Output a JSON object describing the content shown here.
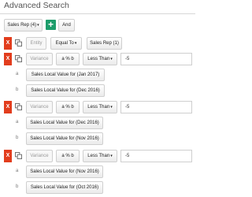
{
  "header": {
    "title": "Advanced Search"
  },
  "toolbar": {
    "sales_rep_label": "Sales Rep (4)",
    "add_symbol": "+",
    "and_label": "And"
  },
  "entity_row": {
    "remove": "X",
    "entity": "Entity",
    "operator": "Equal To",
    "value": "Sales Rep (1)"
  },
  "conditions": [
    {
      "remove": "X",
      "variance": "Variance",
      "formula": "a % b",
      "comparator": "Less Than",
      "value": "-5",
      "a": {
        "letter": "a",
        "label": "Sales Local Value for (Jan 2017)"
      },
      "b": {
        "letter": "b",
        "label": "Sales Local Value for (Dec 2016)"
      }
    },
    {
      "remove": "X",
      "variance": "Variance",
      "formula": "a % b",
      "comparator": "Less Than",
      "value": "-5",
      "a": {
        "letter": "a",
        "label": "Sales Local Value for (Dec 2016)"
      },
      "b": {
        "letter": "b",
        "label": "Sales Local Value for (Nov 2016)"
      }
    },
    {
      "remove": "X",
      "variance": "Variance",
      "formula": "a % b",
      "comparator": "Less Than",
      "value": "-5",
      "a": {
        "letter": "a",
        "label": "Sales Local Value for (Nov 2016)"
      },
      "b": {
        "letter": "b",
        "label": "Sales Local Value for (Oct 2016)"
      }
    }
  ],
  "colors": {
    "remove": "#e23d1d",
    "add": "#1d9d6b"
  },
  "icons": {
    "copy": "copy-icon",
    "caret": "caret-down-icon"
  }
}
